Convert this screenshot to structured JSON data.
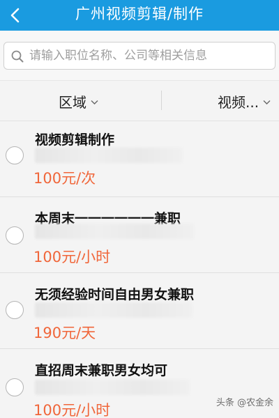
{
  "header": {
    "title": "广州视频剪辑/制作"
  },
  "search": {
    "placeholder": "请输入职位名称、公司等相关信息"
  },
  "filters": {
    "area_label": "区域",
    "video_label": "视频..."
  },
  "jobs": [
    {
      "title": "视频剪辑制作",
      "pay": "100元/次"
    },
    {
      "title": "本周末一一一一一一兼职",
      "pay": "100元/小时"
    },
    {
      "title": "无须经验时间自由男女兼职",
      "pay": "190元/天"
    },
    {
      "title": "直招周末兼职男女均可",
      "pay": "100元/小时"
    }
  ],
  "watermark": "头条 @农金余",
  "colors": {
    "header_bg": "#1a9be0",
    "pay_text": "#f0663a"
  },
  "icons": {
    "back": "chevron-left-icon",
    "search": "search-icon",
    "dropdown": "chevron-down-icon"
  }
}
